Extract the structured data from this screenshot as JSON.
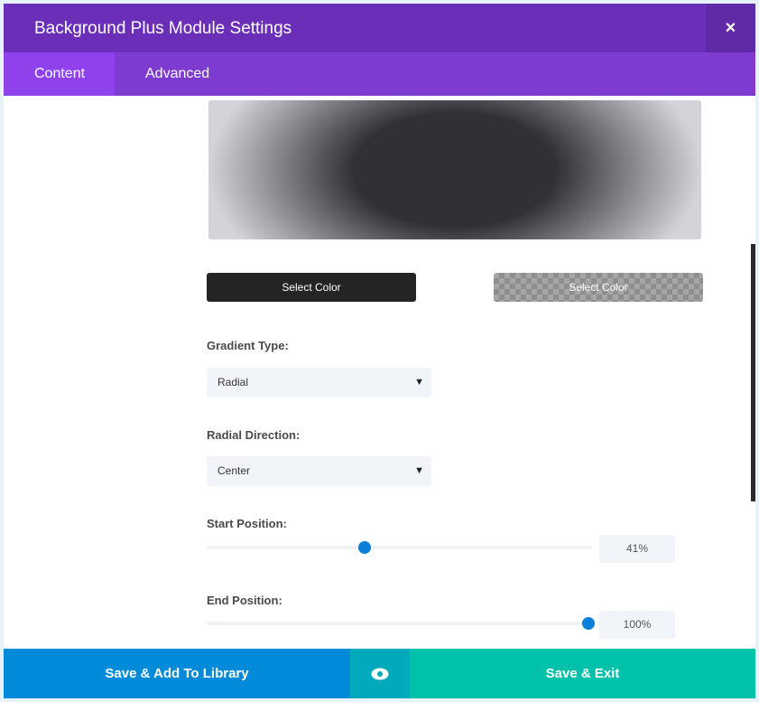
{
  "header": {
    "title": "Background Plus Module Settings",
    "close": "×"
  },
  "tabs": [
    {
      "label": "Content"
    },
    {
      "label": "Advanced"
    }
  ],
  "colors": {
    "start_button": "Select Color",
    "end_button": "Select Color",
    "start_color": "#303134",
    "end_color": "#d3d3da"
  },
  "gradient_type": {
    "label": "Gradient Type:",
    "value": "Radial"
  },
  "radial_direction": {
    "label": "Radial Direction:",
    "value": "Center"
  },
  "start_position": {
    "label": "Start Position:",
    "value": "41%",
    "percent": 41
  },
  "end_position": {
    "label": "End Position:",
    "value": "100%",
    "percent": 100
  },
  "footer": {
    "save_library": "Save & Add To Library",
    "save_exit": "Save & Exit"
  }
}
